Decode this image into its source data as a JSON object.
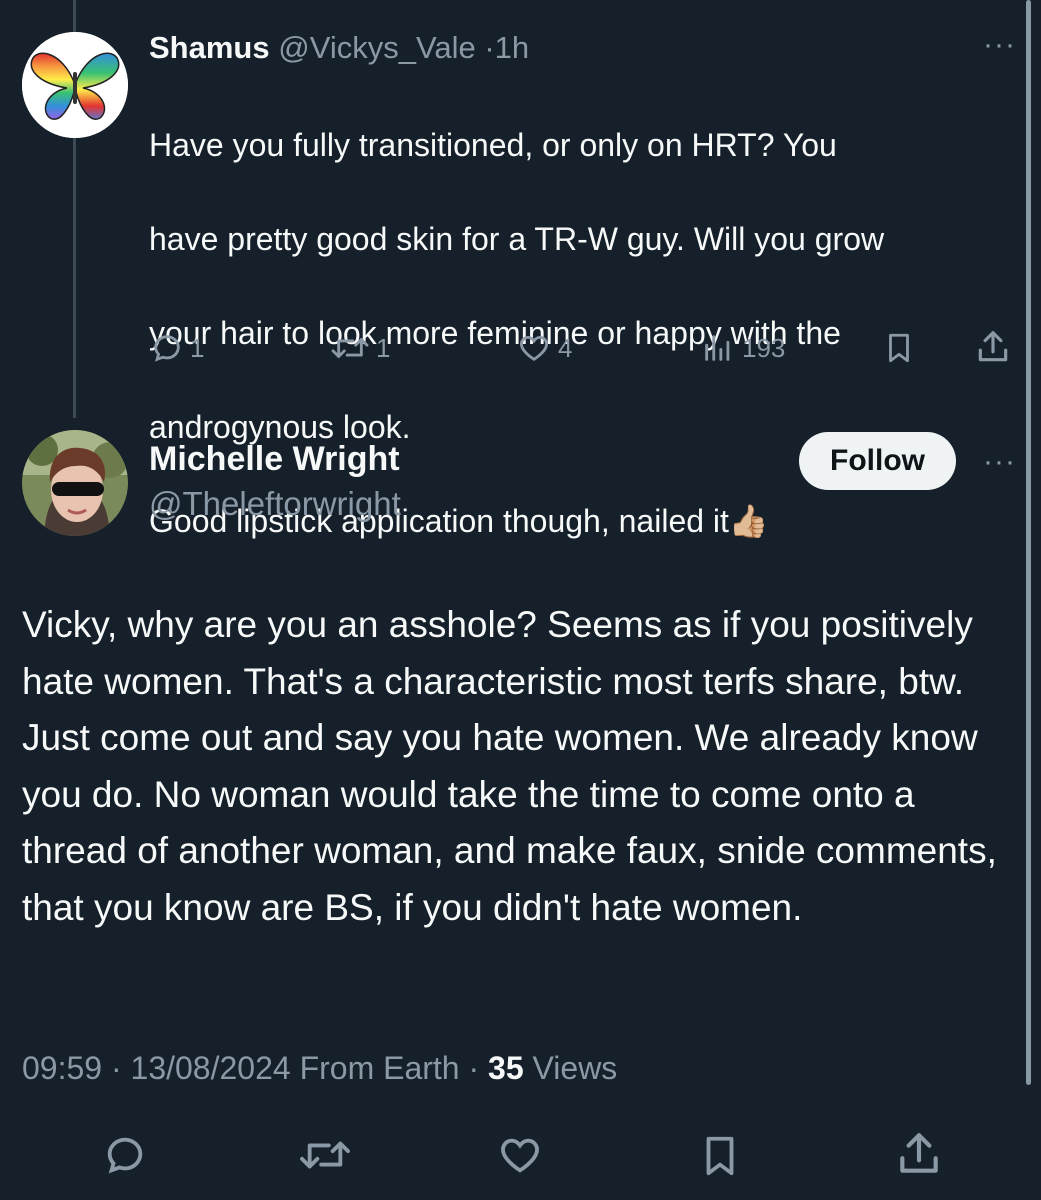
{
  "reply": {
    "name": "Shamus",
    "handle": "@Vickys_Vale",
    "separator": "·",
    "time": "1h",
    "text_lines": [
      "Have you fully transitioned, or only on HRT? You",
      "have pretty good skin for a TR-W guy. Will you grow",
      "your hair to look more feminine or happy with the",
      "androgynous look.",
      "Good lipstick application though, nailed it👍🏼"
    ],
    "stats": {
      "replies": "1",
      "reposts": "1",
      "likes": "4",
      "views": "193"
    },
    "more_label": "···"
  },
  "main": {
    "name": "Michelle Wright",
    "handle": "@Theleftorwright",
    "follow_label": "Follow",
    "more_label": "···",
    "text": "Vicky, why are you an asshole? Seems as if you positively hate women. That's a characteristic most terfs share, btw. Just come out and say you hate women. We already know you do. No woman would take the time to come onto a thread of another woman, and make faux, snide comments, that you know are BS, if you didn't hate women.",
    "time": "09:59",
    "date": "13/08/2024",
    "source": "From Earth",
    "separator": "·",
    "views_count": "35",
    "views_label": "Views"
  },
  "colors": {
    "background": "#15202b",
    "text": "#f7f9f9",
    "muted": "#8b98a5",
    "follow_bg": "#eff3f4"
  },
  "icons": {
    "reply": "comment-icon",
    "repost": "repost-icon",
    "like": "heart-icon",
    "views": "bar-chart-icon",
    "bookmark": "bookmark-icon",
    "share": "share-icon"
  }
}
